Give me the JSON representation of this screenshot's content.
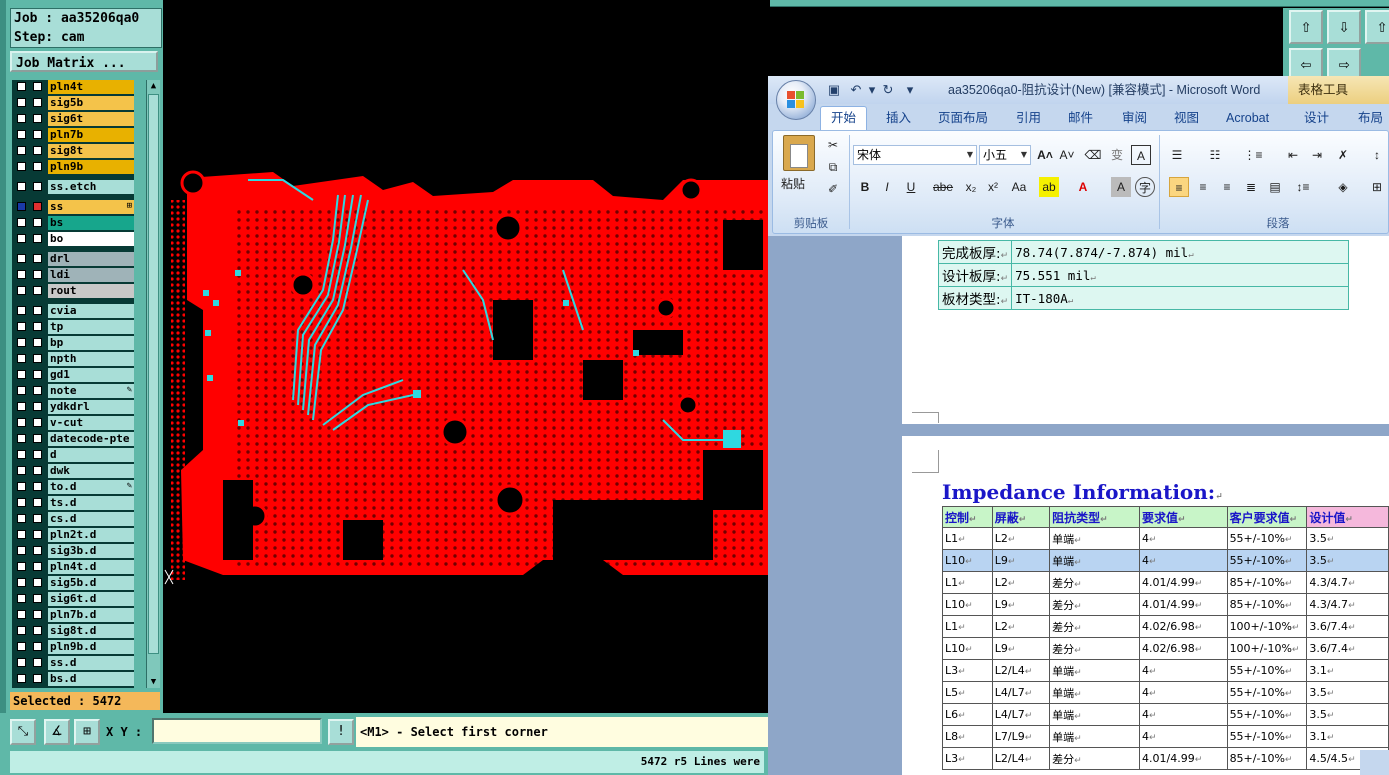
{
  "cam": {
    "job_label": "Job : aa35206qa0",
    "step_label": "Step: cam",
    "job_matrix_button": "Job Matrix ...",
    "layers": [
      {
        "name": "pln4t",
        "color": "#e8b100"
      },
      {
        "name": "sig5b",
        "color": "#f4c34a"
      },
      {
        "name": "sig6t",
        "color": "#f4c34a"
      },
      {
        "name": "pln7b",
        "color": "#e8b100"
      },
      {
        "name": "sig8t",
        "color": "#f4c34a"
      },
      {
        "name": "pln9b",
        "color": "#e8b100"
      },
      {
        "name": "ss.etch",
        "color": "#a8ded7"
      },
      {
        "name": "ss",
        "color": "#f4c34a",
        "flag": "⊞"
      },
      {
        "name": "bs",
        "color": "#17a68c"
      },
      {
        "name": "bo",
        "color": "#ffffff"
      },
      {
        "name": "drl",
        "color": "#9fb3b8"
      },
      {
        "name": "ldi",
        "color": "#9fb3b8"
      },
      {
        "name": "rout",
        "color": "#c8c8c8"
      },
      {
        "name": "cvia",
        "color": "#a8ded7"
      },
      {
        "name": "tp",
        "color": "#a8ded7"
      },
      {
        "name": "bp",
        "color": "#a8ded7"
      },
      {
        "name": "npth",
        "color": "#a8ded7"
      },
      {
        "name": "gd1",
        "color": "#a8ded7"
      },
      {
        "name": "note",
        "color": "#a8ded7",
        "flag": "✎"
      },
      {
        "name": "ydkdrl",
        "color": "#a8ded7"
      },
      {
        "name": "v-cut",
        "color": "#a8ded7"
      },
      {
        "name": "datecode-pte",
        "color": "#a8ded7"
      },
      {
        "name": "d",
        "color": "#a8ded7"
      },
      {
        "name": "dwk",
        "color": "#a8ded7"
      },
      {
        "name": "to.d",
        "color": "#a8ded7",
        "flag": "✎"
      },
      {
        "name": "ts.d",
        "color": "#a8ded7"
      },
      {
        "name": "cs.d",
        "color": "#a8ded7"
      },
      {
        "name": "pln2t.d",
        "color": "#a8ded7"
      },
      {
        "name": "sig3b.d",
        "color": "#a8ded7"
      },
      {
        "name": "pln4t.d",
        "color": "#a8ded7"
      },
      {
        "name": "sig5b.d",
        "color": "#a8ded7"
      },
      {
        "name": "sig6t.d",
        "color": "#a8ded7"
      },
      {
        "name": "pln7b.d",
        "color": "#a8ded7"
      },
      {
        "name": "sig8t.d",
        "color": "#a8ded7"
      },
      {
        "name": "pln9b.d",
        "color": "#a8ded7"
      },
      {
        "name": "ss.d",
        "color": "#a8ded7"
      },
      {
        "name": "bs.d",
        "color": "#a8ded7"
      }
    ],
    "selected_text": "Selected : 5472",
    "xy_label": "X Y :",
    "xy_value": "",
    "prompt_message": "<M1> - Select first corner",
    "status_message": "5472 r5 Lines were",
    "colors": {
      "panel": "#5fb8a8",
      "board": "#ff0000",
      "traces": "#2fd8e0"
    }
  },
  "word": {
    "window_title": "aa35206qa0-阻抗设计(New) [兼容模式] - Microsoft Word",
    "context_tab": "表格工具",
    "tabs": [
      "开始",
      "插入",
      "页面布局",
      "引用",
      "邮件",
      "审阅",
      "视图",
      "Acrobat",
      "设计",
      "布局"
    ],
    "ribbon": {
      "paste_label": "粘贴",
      "clipboard_group": "剪贴板",
      "font_group": "字体",
      "paragraph_group": "段落",
      "font_name": "宋体",
      "font_size": "小五"
    },
    "top_table": [
      {
        "label": "完成板厚:",
        "value": "78.74(7.874/-7.874) mil"
      },
      {
        "label": "设计板厚:",
        "value": "75.551 mil"
      },
      {
        "label": "板材类型:",
        "value": "IT-180A"
      }
    ],
    "impedance_title": "Impedance Information:",
    "impedance_headers": [
      "控制",
      "屏蔽",
      "阻抗类型",
      "要求值",
      "客户要求值",
      "设计值"
    ],
    "impedance_rows": [
      [
        "L1",
        "L2",
        "单端",
        "4",
        "55+/-10%",
        "3.5"
      ],
      [
        "L10",
        "L9",
        "单端",
        "4",
        "55+/-10%",
        "3.5"
      ],
      [
        "L1",
        "L2",
        "差分",
        "4.01/4.99",
        "85+/-10%",
        "4.3/4.7"
      ],
      [
        "L10",
        "L9",
        "差分",
        "4.01/4.99",
        "85+/-10%",
        "4.3/4.7"
      ],
      [
        "L1",
        "L2",
        "差分",
        "4.02/6.98",
        "100+/-10%",
        "3.6/7.4"
      ],
      [
        "L10",
        "L9",
        "差分",
        "4.02/6.98",
        "100+/-10%",
        "3.6/7.4"
      ],
      [
        "L3",
        "L2/L4",
        "单端",
        "4",
        "55+/-10%",
        "3.1"
      ],
      [
        "L5",
        "L4/L7",
        "单端",
        "4",
        "55+/-10%",
        "3.5"
      ],
      [
        "L6",
        "L4/L7",
        "单端",
        "4",
        "55+/-10%",
        "3.5"
      ],
      [
        "L8",
        "L7/L9",
        "单端",
        "4",
        "55+/-10%",
        "3.1"
      ],
      [
        "L3",
        "L2/L4",
        "差分",
        "4.01/4.99",
        "85+/-10%",
        "4.5/4.5"
      ]
    ],
    "highlighted_row": 1
  }
}
